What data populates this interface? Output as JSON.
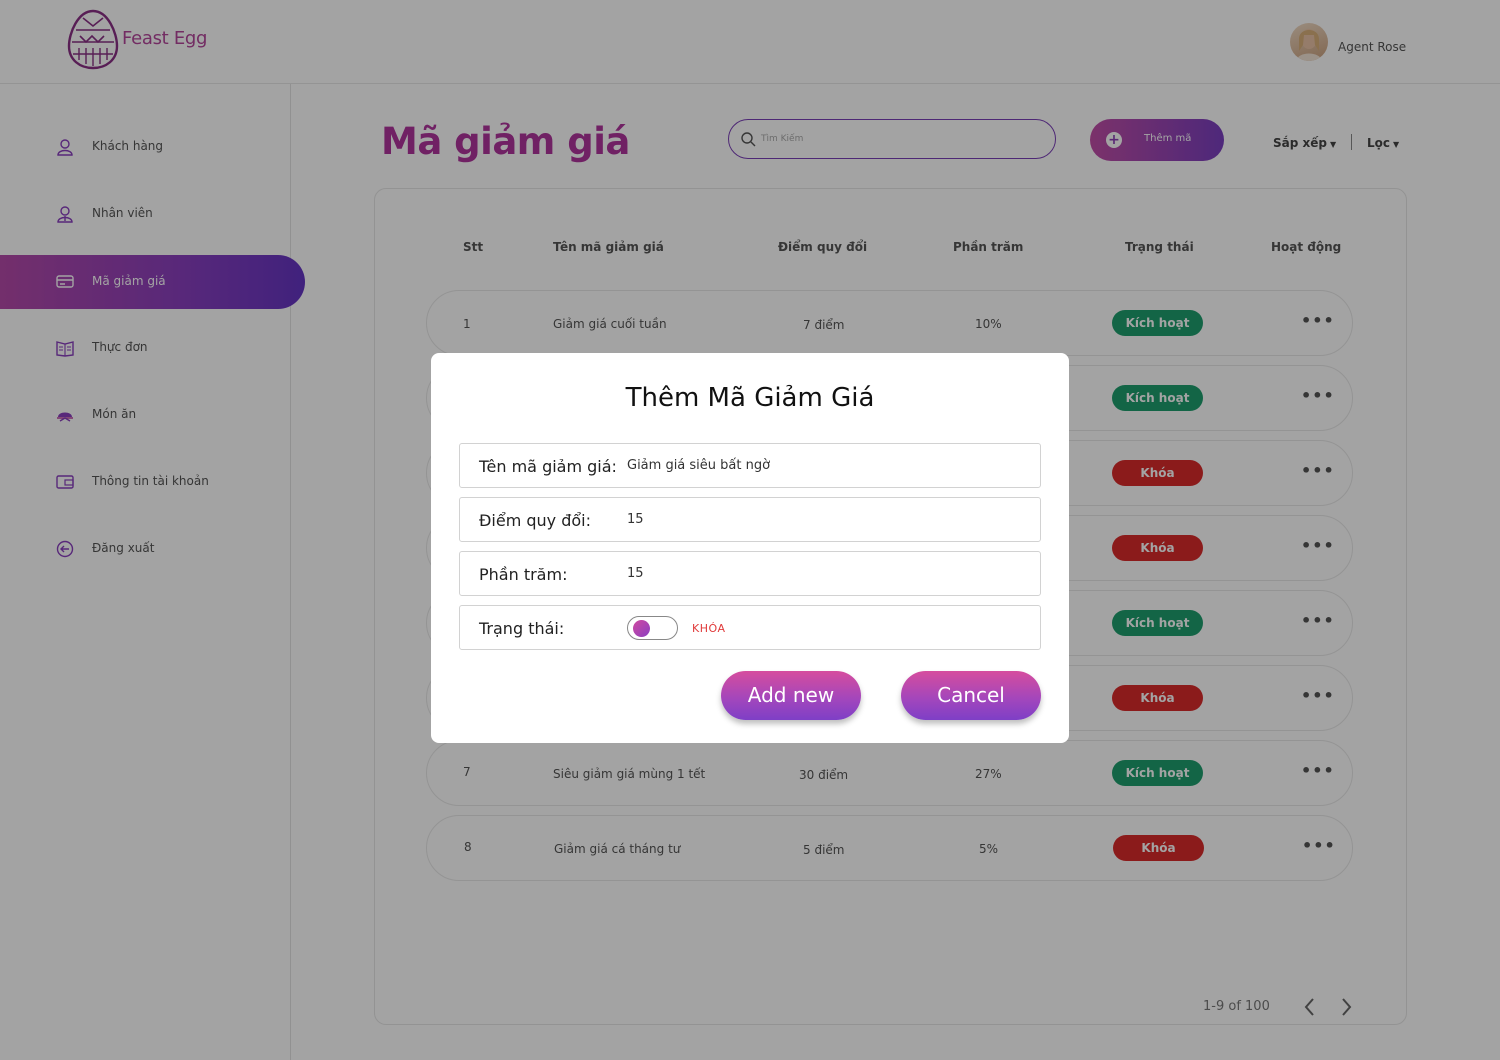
{
  "header": {
    "brand": "Feast Egg",
    "user_name": "Agent Rose"
  },
  "sidebar": {
    "items": [
      {
        "label": "Khách hàng",
        "icon": "user-icon"
      },
      {
        "label": "Nhân viên",
        "icon": "staff-icon"
      },
      {
        "label": "Mã giảm giá",
        "icon": "ticket-icon",
        "active": true
      },
      {
        "label": "Thực đơn",
        "icon": "menu-book-icon"
      },
      {
        "label": "Món ăn",
        "icon": "dish-icon"
      },
      {
        "label": "Thông tin tài khoản",
        "icon": "wallet-icon"
      },
      {
        "label": "Đăng xuất",
        "icon": "logout-icon"
      }
    ]
  },
  "main": {
    "title": "Mã giảm giá",
    "search_placeholder": "Tìm Kiếm",
    "add_label": "Thêm mã",
    "sort_label": "Sắp xếp",
    "filter_label": "Lọc",
    "columns": [
      "Stt",
      "Tên mã giảm giá",
      "Điểm quy đổi",
      "Phần trăm",
      "Trạng thái",
      "Hoạt động"
    ],
    "rows": [
      {
        "stt": "1",
        "name": "Giảm giá cuối tuần",
        "points": "7 điểm",
        "percent": "10%",
        "status": "Kích hoạt"
      },
      {
        "stt": "",
        "name": "",
        "points": "",
        "percent": "",
        "status": "Kích hoạt"
      },
      {
        "stt": "",
        "name": "",
        "points": "",
        "percent": "",
        "status": "Khóa"
      },
      {
        "stt": "",
        "name": "",
        "points": "",
        "percent": "",
        "status": "Khóa"
      },
      {
        "stt": "",
        "name": "",
        "points": "",
        "percent": "",
        "status": "Kích hoạt"
      },
      {
        "stt": "",
        "name": "",
        "points": "",
        "percent": "",
        "status": "Khóa"
      },
      {
        "stt": "7",
        "name": "Siêu giảm giá mùng 1 tết",
        "points": "30 điểm",
        "percent": "27%",
        "status": "Kích hoạt"
      },
      {
        "stt": "8",
        "name": "Giảm giá cá tháng tư",
        "points": "5 điểm",
        "percent": "5%",
        "status": "Khóa"
      }
    ],
    "actions_glyph": "•••",
    "pagination": "1-9 of 100"
  },
  "modal": {
    "title": "Thêm Mã Giảm Giá",
    "fields": {
      "name_label": "Tên mã giảm giá:",
      "name_value": "Giảm giá siêu bất ngờ",
      "points_label": "Điểm quy đổi:",
      "points_value": "15",
      "percent_label": "Phần trăm:",
      "percent_value": "15",
      "status_label": "Trạng thái:",
      "status_value": "KHÓA"
    },
    "add_button": "Add new",
    "cancel_button": "Cancel"
  },
  "colors": {
    "brand": "#b0359d",
    "accent_gradient_start": "#c14ea7",
    "accent_gradient_end": "#7a3fc0",
    "active_badge": "#1f9e6e",
    "locked_badge": "#d92b2b"
  }
}
